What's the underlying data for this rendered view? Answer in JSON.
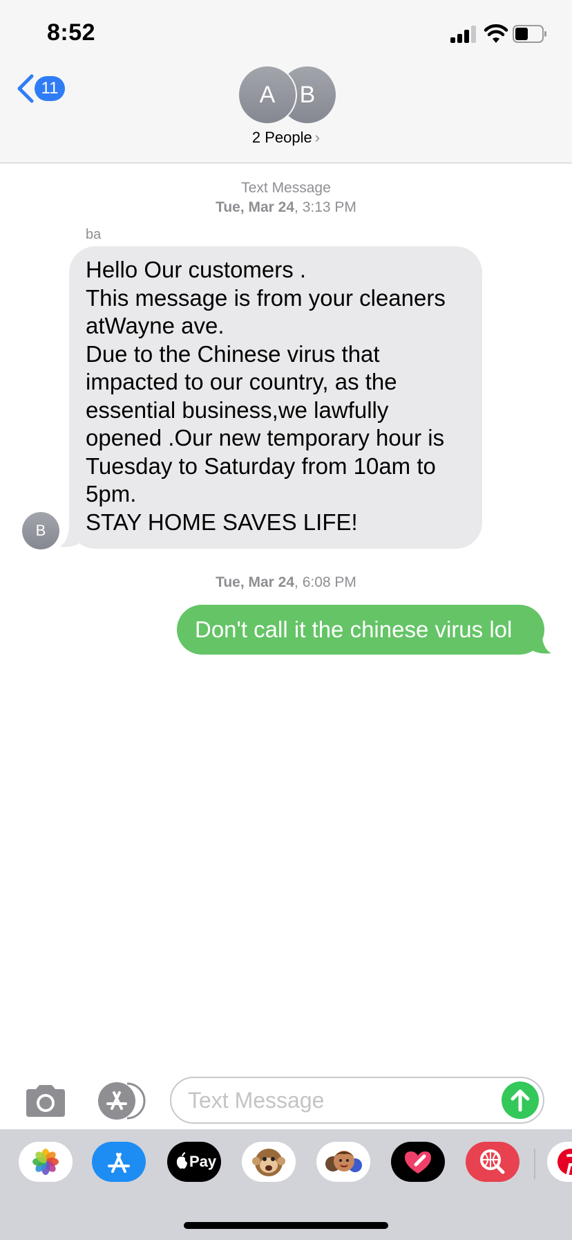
{
  "status_bar": {
    "time": "8:52"
  },
  "header": {
    "back_count": "11",
    "avatar_a": "A",
    "avatar_b": "B",
    "people_label": "2 People"
  },
  "conversation": {
    "service_label": "Text Message",
    "first_stamp_date": "Tue, Mar 24",
    "first_stamp_time": ", 3:13 PM",
    "sender_name": "ba",
    "sender_avatar": "B",
    "incoming_message": "Hello Our customers .\nThis message is from your cleaners atWayne ave.\nDue to the Chinese virus that impacted to our country, as the essential business,we lawfully opened .Our new temporary hour is Tuesday to Saturday from 10am to 5pm.\nSTAY HOME SAVES LIFE!",
    "second_stamp_date": "Tue, Mar 24",
    "second_stamp_time": ", 6:08 PM",
    "outgoing_message": "Don't call it the chinese virus lol"
  },
  "composer": {
    "placeholder": "Text Message"
  },
  "app_drawer": {
    "apps": [
      "photos-app",
      "app-store-app",
      "apple-pay-app",
      "animoji-app",
      "memoji-app",
      "digital-touch-app",
      "web-images-app",
      "pinterest-app"
    ],
    "apple_pay_label": "Pay"
  },
  "colors": {
    "imessage_blue": "#2f7cf6",
    "sms_green": "#64c466",
    "incoming_gray": "#e9e9eb",
    "send_green": "#34c759"
  }
}
